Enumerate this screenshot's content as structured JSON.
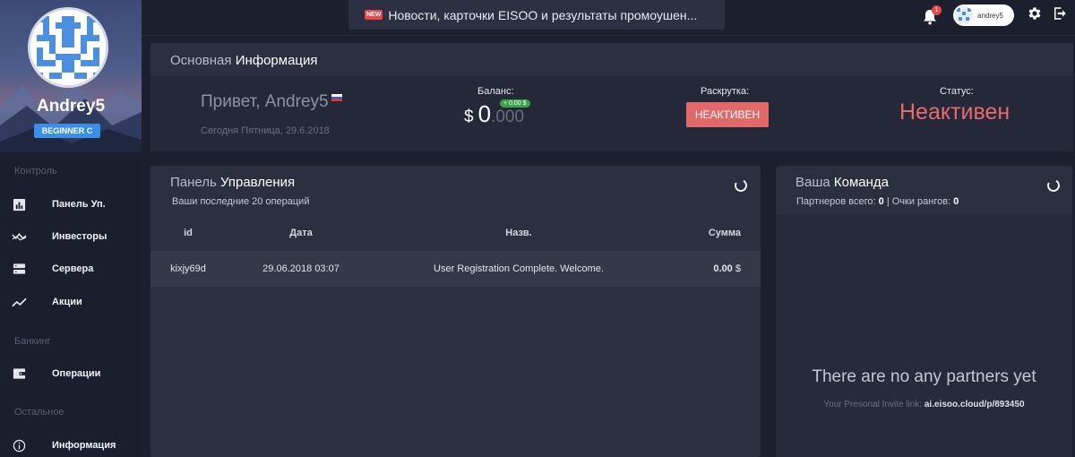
{
  "news": {
    "badge": "NEW",
    "text": "Новости, карточки EISOO и результаты промоушен..."
  },
  "topbar": {
    "notification_count": "1",
    "username": "andrey5"
  },
  "profile": {
    "name": "Andrey5",
    "rank": "BEGINNER C"
  },
  "sidebar": {
    "sections": [
      {
        "title": "Контроль",
        "items": [
          {
            "label": "Панель Уп.",
            "icon": "dashboard-icon"
          },
          {
            "label": "Инвесторы",
            "icon": "investors-icon"
          },
          {
            "label": "Сервера",
            "icon": "servers-icon"
          },
          {
            "label": "Акции",
            "icon": "trending-icon"
          }
        ]
      },
      {
        "title": "Банкинг",
        "items": [
          {
            "label": "Операции",
            "icon": "wallet-icon"
          }
        ]
      },
      {
        "title": "Остальное",
        "items": [
          {
            "label": "Информация",
            "icon": "info-icon"
          }
        ]
      }
    ]
  },
  "info": {
    "title_light": "Основная",
    "title_bold": "Информация",
    "greeting": "Привет, Andrey5",
    "today": "Сегодня Пятница, 29.6.2018",
    "balance_label": "Баланс:",
    "balance_currency": "$",
    "balance_int": "0",
    "balance_dec": ".000",
    "balance_change": "+ 0.00 $",
    "promo_label": "Раскрутка:",
    "promo_button": "НЕАКТИВЕН",
    "status_label": "Статус:",
    "status_value": "Неактивен"
  },
  "panel": {
    "title_light": "Панель",
    "title_bold": "Управления",
    "subtitle": "Ваши последние 20 операций",
    "columns": [
      "id",
      "Дата",
      "Назв.",
      "Сумма"
    ],
    "rows": [
      {
        "id": "kixjy69d",
        "date": "29.06.2018 03:07",
        "name": "User Registration Complete. Welcome.",
        "amount": "0.00",
        "currency": "$"
      }
    ]
  },
  "team": {
    "title_light": "Ваша",
    "title_bold": "Команда",
    "partners_label": "Партнеров всего:",
    "partners_value": "0",
    "separator": "|",
    "points_label": "Очки рангов:",
    "points_value": "0",
    "empty_text": "There are no any partners yet",
    "invite_label": "Your Presonal Invite link:",
    "invite_link": "ai.eisoo.cloud/p/893450"
  },
  "colors": {
    "accent_blue": "#3b8ee8",
    "status_red": "#e86a6d",
    "button_red": "#e2696a",
    "positive_green": "#3aa54a"
  }
}
